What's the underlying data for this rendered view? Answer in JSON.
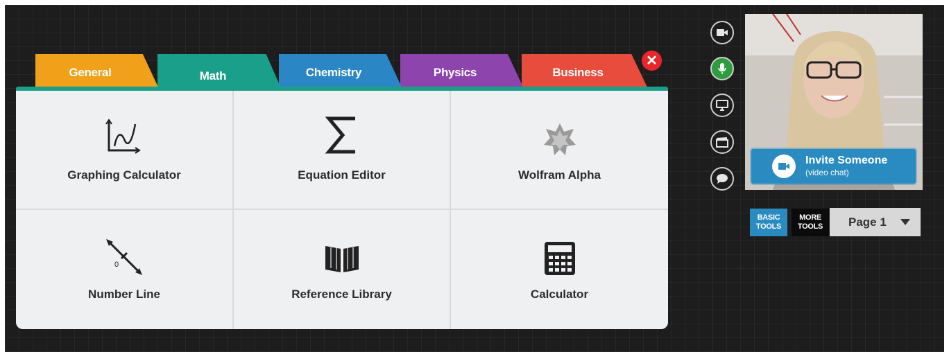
{
  "tabs": [
    {
      "label": "General",
      "color": "#f0a019"
    },
    {
      "label": "Math",
      "color": "#1aa08a"
    },
    {
      "label": "Chemistry",
      "color": "#2b86c5"
    },
    {
      "label": "Physics",
      "color": "#8e44ad"
    },
    {
      "label": "Business",
      "color": "#e74c3c"
    }
  ],
  "active_tab": "Math",
  "close_icon": "close-icon",
  "tools": [
    {
      "label": "Graphing Calculator",
      "icon": "graph-icon"
    },
    {
      "label": "Equation Editor",
      "icon": "sigma-icon"
    },
    {
      "label": "Wolfram Alpha",
      "icon": "wolfram-star-icon"
    },
    {
      "label": "Number Line",
      "icon": "number-line-icon",
      "icon_text": "0"
    },
    {
      "label": "Reference Library",
      "icon": "book-icon"
    },
    {
      "label": "Calculator",
      "icon": "calculator-icon"
    }
  ],
  "side_controls": [
    "video-camera-icon",
    "microphone-icon",
    "screen-share-icon",
    "clapperboard-icon",
    "chat-icon"
  ],
  "invite": {
    "title": "Invite Someone",
    "subtitle": "(video chat)"
  },
  "tool_buttons": {
    "basic": "BASIC TOOLS",
    "more": "MORE TOOLS"
  },
  "page_select": {
    "value": "Page 1"
  },
  "colors": {
    "mic_active": "#2e9b3e",
    "invite_bg": "#2a8bc1",
    "basic_tools_bg": "#2a8bc1",
    "close": "#e8262b"
  }
}
